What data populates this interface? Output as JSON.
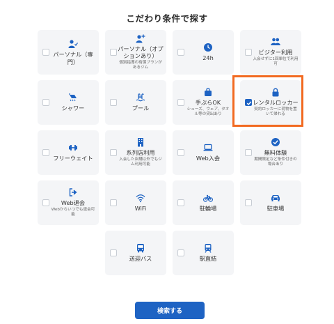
{
  "title": "こだわり条件で探す",
  "accent_color": "#1e63c3",
  "highlight_color": "#f26a21",
  "search_button_label": "検索する",
  "conditions": [
    {
      "label": "パーソナル（専門）",
      "sub": "",
      "icon": "personal-trainer-icon",
      "checked": false
    },
    {
      "label": "パーソナル（オプションあり）",
      "sub": "個別指導の有償プランがあるジム",
      "icon": "person-add-icon",
      "checked": false
    },
    {
      "label": "24h",
      "sub": "",
      "icon": "clock-icon",
      "checked": false
    },
    {
      "label": "ビジター利用",
      "sub": "入会せずに1回単位で利用可",
      "icon": "visitors-icon",
      "checked": false
    },
    {
      "label": "シャワー",
      "sub": "",
      "icon": "shower-icon",
      "checked": false
    },
    {
      "label": "プール",
      "sub": "",
      "icon": "pool-icon",
      "checked": false
    },
    {
      "label": "手ぶらOK",
      "sub": "シューズ、ウェア、タオル等の貸出あり",
      "icon": "bag-icon",
      "checked": false
    },
    {
      "label": "レンタルロッカー",
      "sub": "契約ロッカーに荷物を置いて帰れる",
      "icon": "lock-icon",
      "checked": true
    },
    {
      "label": "フリーウェイト",
      "sub": "",
      "icon": "dumbbell-icon",
      "checked": false
    },
    {
      "label": "系列店利用",
      "sub": "入会した店舗以外でもジム利用可能",
      "icon": "building-icon",
      "checked": false
    },
    {
      "label": "Web入会",
      "sub": "",
      "icon": "laptop-icon",
      "checked": false
    },
    {
      "label": "無料体験",
      "sub": "期間限定など条件付きの場合あり",
      "icon": "check-badge-icon",
      "checked": false
    },
    {
      "label": "Web退会",
      "sub": "Webからいつでも退会可能",
      "icon": "exit-icon",
      "checked": false
    },
    {
      "label": "WiFi",
      "sub": "",
      "icon": "wifi-icon",
      "checked": false
    },
    {
      "label": "駐輪場",
      "sub": "",
      "icon": "bicycle-icon",
      "checked": false
    },
    {
      "label": "駐車場",
      "sub": "",
      "icon": "car-icon",
      "checked": false
    },
    {
      "label": "送迎バス",
      "sub": "",
      "icon": "bus-icon",
      "checked": false
    },
    {
      "label": "駅直結",
      "sub": "",
      "icon": "train-icon",
      "checked": false
    }
  ]
}
